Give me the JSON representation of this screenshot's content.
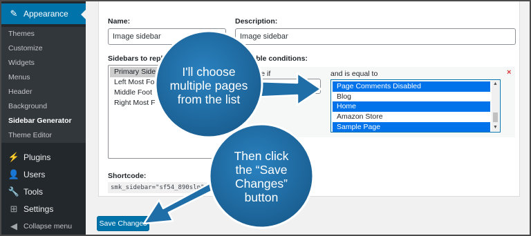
{
  "sidebar": {
    "appearance_label": "Appearance",
    "submenu": [
      {
        "label": "Themes"
      },
      {
        "label": "Customize"
      },
      {
        "label": "Widgets"
      },
      {
        "label": "Menus"
      },
      {
        "label": "Header"
      },
      {
        "label": "Background"
      },
      {
        "label": "Sidebar Generator",
        "current": true
      },
      {
        "label": "Theme Editor"
      }
    ],
    "plugins_label": "Plugins",
    "users_label": "Users",
    "tools_label": "Tools",
    "settings_label": "Settings",
    "collapse_label": "Collapse menu"
  },
  "form": {
    "name_label": "Name:",
    "name_value": "Image sidebar",
    "description_label": "Description:",
    "description_value": "Image sidebar",
    "sidebars_label": "Sidebars to repl",
    "sidebar_options": [
      "Primary Side",
      "Left Most Fo",
      "Middle Foot",
      "Right Most F"
    ],
    "conditions_label": "nable conditions:",
    "replace_if_label": "place if",
    "equal_to_label": "and is equal to",
    "pages": [
      "Page Comments Disabled",
      "Blog",
      "Home",
      "Amazon Store",
      "Sample Page"
    ],
    "pages_selected": [
      true,
      false,
      true,
      false,
      true
    ],
    "remove_symbol": "×",
    "shortcode_label": "Shortcode:",
    "shortcode_value": "smk_sidebar=\"sf54_890slp\"",
    "save_label": "Save Changes"
  },
  "callouts": {
    "first": "I'll choose\nmultiple pages\nfrom the list",
    "second": "Then click\nthe “Save\nChanges”\nbutton"
  },
  "colors": {
    "admin_dark": "#23282d",
    "wp_blue": "#0073aa",
    "selection_blue": "#0073ea",
    "callout_blue": "#1f6ea8"
  }
}
